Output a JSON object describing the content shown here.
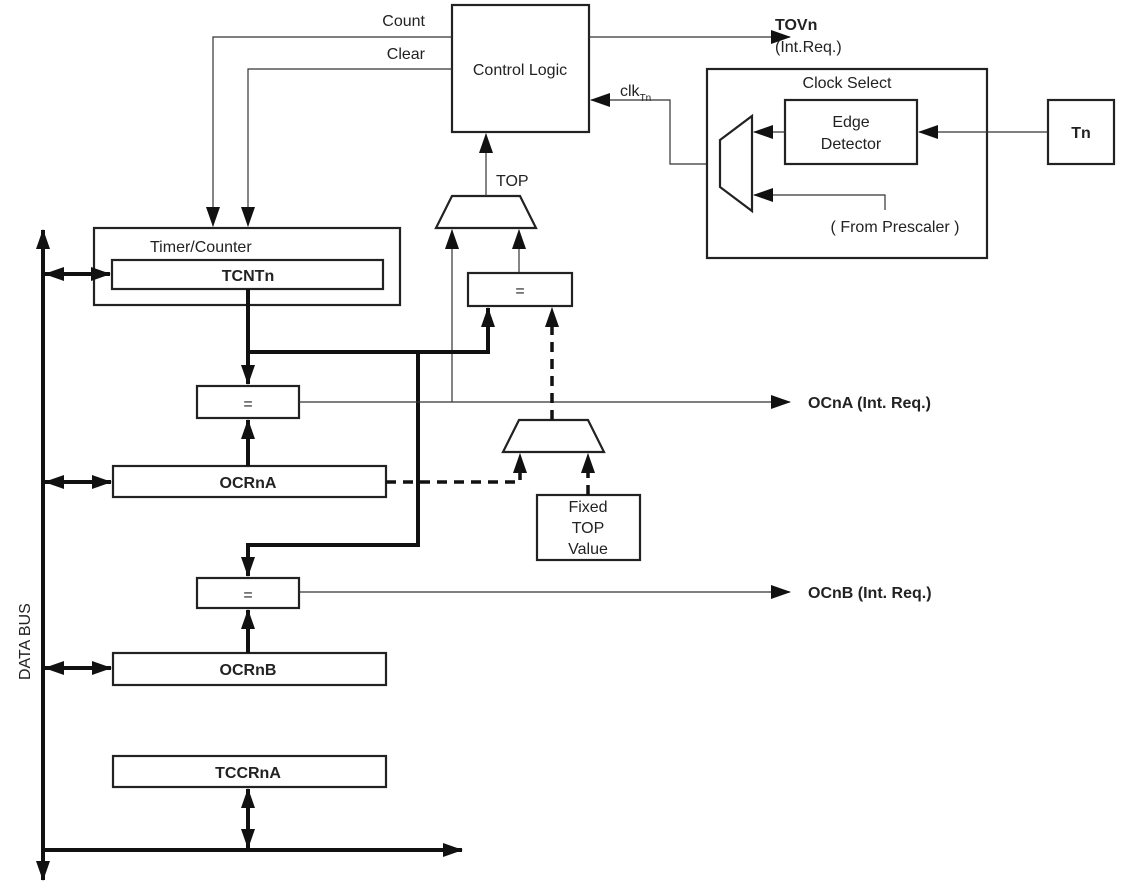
{
  "diagram": {
    "control_logic": "Control Logic",
    "count": "Count",
    "clear": "Clear",
    "tovn": "TOVn",
    "tovn_req": "(Int.Req.)",
    "clk": "clk",
    "clk_sub": "Tn",
    "clock_select": "Clock Select",
    "edge_detector_1": "Edge",
    "edge_detector_2": "Detector",
    "tn": "Tn",
    "from_prescaler": "( From Prescaler )",
    "top": "TOP",
    "timer_counter": "Timer/Counter",
    "tcntn": "TCNTn",
    "eq": "=",
    "ocna_out": "OCnA (Int. Req.)",
    "ocrna": "OCRnA",
    "fixed_top_1": "Fixed",
    "fixed_top_2": "TOP",
    "fixed_top_3": "Value",
    "ocnb_out": "OCnB (Int. Req.)",
    "ocrnb": "OCRnB",
    "tccrna": "TCCRnA",
    "data_bus": "DATA BUS"
  }
}
